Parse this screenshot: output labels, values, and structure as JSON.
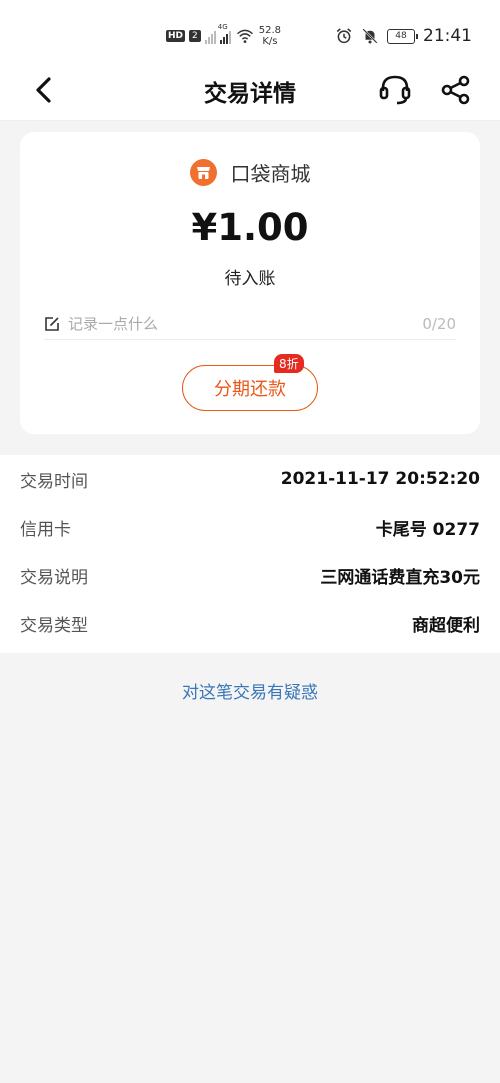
{
  "status_bar": {
    "hd": "HD",
    "sim": "2",
    "network": "4G",
    "speed_value": "52.8",
    "speed_unit": "K/s",
    "battery": "48",
    "time": "21:41"
  },
  "nav": {
    "title": "交易详情",
    "icons": [
      "back-arrow-icon",
      "customer-service-icon",
      "share-icon"
    ]
  },
  "summary": {
    "merchant_name": "口袋商城",
    "merchant_logo": "shop-icon",
    "amount": "¥1.00",
    "status": "待入账",
    "note_placeholder": "记录一点什么",
    "note_value": "",
    "note_count": "0/20",
    "installment_label": "分期还款",
    "discount_badge": "8折"
  },
  "details": [
    {
      "label": "交易时间",
      "value": "2021-11-17 20:52:20"
    },
    {
      "label": "信用卡",
      "value": "卡尾号 0277"
    },
    {
      "label": "交易说明",
      "value": "三网通话费直充30元"
    },
    {
      "label": "交易类型",
      "value": "商超便利"
    }
  ],
  "dispute_link": "对这笔交易有疑惑",
  "colors": {
    "accent": "#e8591a",
    "badge": "#e52a1f",
    "link": "#3a76b8",
    "background": "#f4f4f4"
  }
}
